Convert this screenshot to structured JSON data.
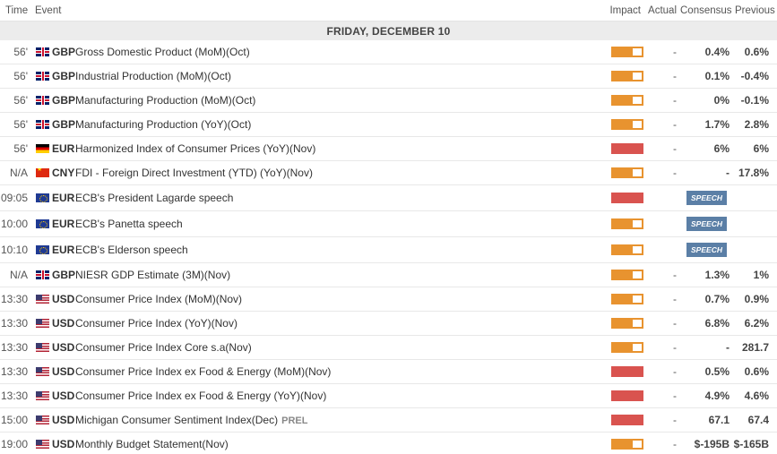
{
  "header": {
    "time": "Time",
    "event": "Event",
    "impact": "Impact",
    "actual": "Actual",
    "consensus": "Consensus",
    "previous": "Previous"
  },
  "day_label": "FRIDAY, DECEMBER 10",
  "rows": [
    {
      "time": "56'",
      "flag": "gb",
      "currency": "GBP",
      "event": "Gross Domestic Product (MoM)(Oct)",
      "impact": "medium",
      "actual": "-",
      "consensus": "0.4%",
      "previous": "0.6%"
    },
    {
      "time": "56'",
      "flag": "gb",
      "currency": "GBP",
      "event": "Industrial Production (MoM)(Oct)",
      "impact": "medium",
      "actual": "-",
      "consensus": "0.1%",
      "previous": "-0.4%"
    },
    {
      "time": "56'",
      "flag": "gb",
      "currency": "GBP",
      "event": "Manufacturing Production (MoM)(Oct)",
      "impact": "medium",
      "actual": "-",
      "consensus": "0%",
      "previous": "-0.1%"
    },
    {
      "time": "56'",
      "flag": "gb",
      "currency": "GBP",
      "event": "Manufacturing Production (YoY)(Oct)",
      "impact": "medium",
      "actual": "-",
      "consensus": "1.7%",
      "previous": "2.8%"
    },
    {
      "time": "56'",
      "flag": "de",
      "currency": "EUR",
      "event": "Harmonized Index of Consumer Prices (YoY)(Nov)",
      "impact": "high",
      "actual": "-",
      "consensus": "6%",
      "previous": "6%"
    },
    {
      "time": "N/A",
      "flag": "cn",
      "currency": "CNY",
      "event": "FDI - Foreign Direct Investment (YTD) (YoY)(Nov)",
      "impact": "medium",
      "actual": "-",
      "consensus": "-",
      "previous": "17.8%"
    },
    {
      "time": "09:05",
      "flag": "eu",
      "currency": "EUR",
      "event": "ECB's President Lagarde speech",
      "impact": "high",
      "speech": "SPEECH"
    },
    {
      "time": "10:00",
      "flag": "eu",
      "currency": "EUR",
      "event": "ECB's Panetta speech",
      "impact": "medium",
      "speech": "SPEECH"
    },
    {
      "time": "10:10",
      "flag": "eu",
      "currency": "EUR",
      "event": "ECB's Elderson speech",
      "impact": "medium",
      "speech": "SPEECH"
    },
    {
      "time": "N/A",
      "flag": "gb",
      "currency": "GBP",
      "event": "NIESR GDP Estimate (3M)(Nov)",
      "impact": "medium",
      "actual": "-",
      "consensus": "1.3%",
      "previous": "1%"
    },
    {
      "time": "13:30",
      "flag": "us",
      "currency": "USD",
      "event": "Consumer Price Index (MoM)(Nov)",
      "impact": "medium",
      "actual": "-",
      "consensus": "0.7%",
      "previous": "0.9%"
    },
    {
      "time": "13:30",
      "flag": "us",
      "currency": "USD",
      "event": "Consumer Price Index (YoY)(Nov)",
      "impact": "medium",
      "actual": "-",
      "consensus": "6.8%",
      "previous": "6.2%"
    },
    {
      "time": "13:30",
      "flag": "us",
      "currency": "USD",
      "event": "Consumer Price Index Core s.a(Nov)",
      "impact": "medium",
      "actual": "-",
      "consensus": "-",
      "previous": "281.7"
    },
    {
      "time": "13:30",
      "flag": "us",
      "currency": "USD",
      "event": "Consumer Price Index ex Food & Energy (MoM)(Nov)",
      "impact": "high",
      "actual": "-",
      "consensus": "0.5%",
      "previous": "0.6%"
    },
    {
      "time": "13:30",
      "flag": "us",
      "currency": "USD",
      "event": "Consumer Price Index ex Food & Energy (YoY)(Nov)",
      "impact": "high",
      "actual": "-",
      "consensus": "4.9%",
      "previous": "4.6%"
    },
    {
      "time": "15:00",
      "flag": "us",
      "currency": "USD",
      "event": "Michigan Consumer Sentiment Index(Dec)",
      "prel": "PREL",
      "impact": "high",
      "actual": "-",
      "consensus": "67.1",
      "previous": "67.4"
    },
    {
      "time": "19:00",
      "flag": "us",
      "currency": "USD",
      "event": "Monthly Budget Statement(Nov)",
      "impact": "medium",
      "actual": "-",
      "consensus": "$-195B",
      "previous": "$-165B"
    }
  ],
  "colors": {
    "impact_medium": "#e8932f",
    "impact_high": "#d9534f",
    "speech_badge": "#5b7fa6"
  }
}
